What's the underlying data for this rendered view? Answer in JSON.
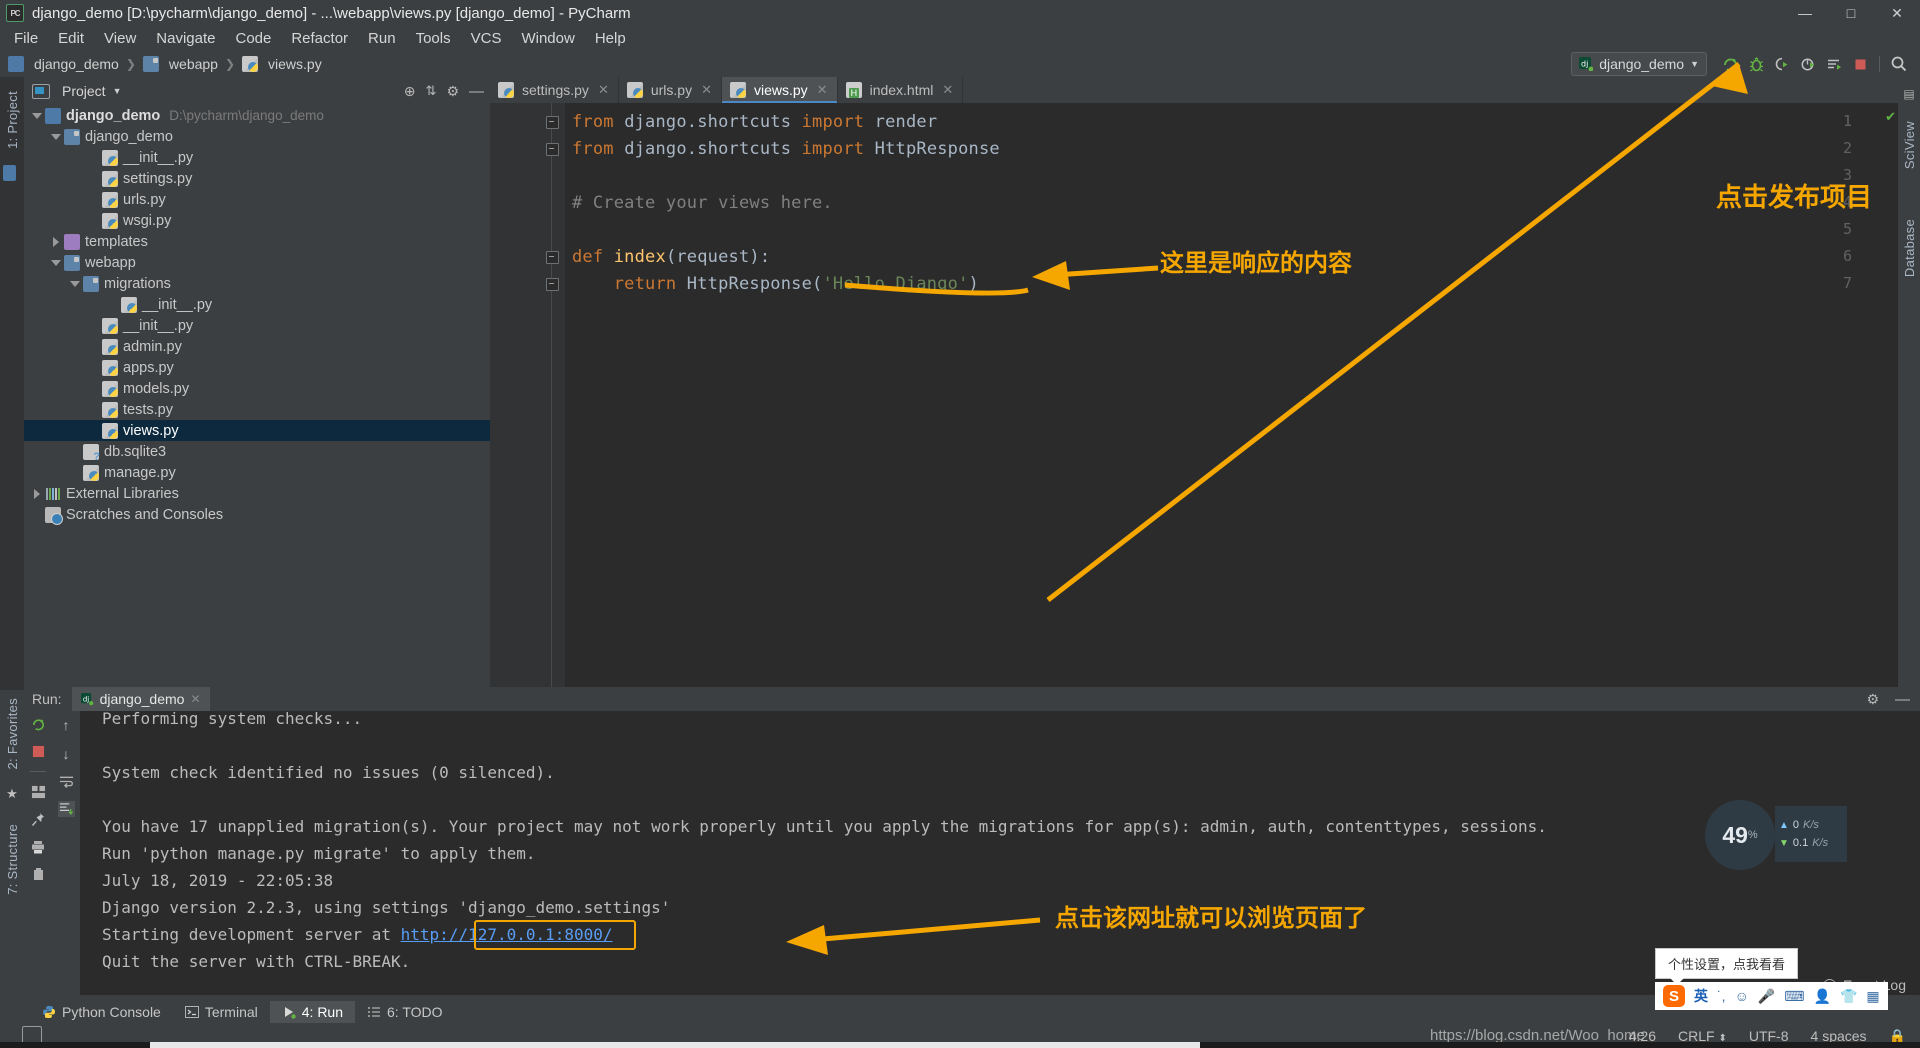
{
  "window": {
    "title": "django_demo [D:\\pycharm\\django_demo] - ...\\webapp\\views.py [django_demo] - PyCharm",
    "app_icon_text": "PC",
    "minimize": "—",
    "maximize": "□",
    "close": "✕"
  },
  "menu": [
    "File",
    "Edit",
    "View",
    "Navigate",
    "Code",
    "Refactor",
    "Run",
    "Tools",
    "VCS",
    "Window",
    "Help"
  ],
  "breadcrumb": [
    "django_demo",
    "webapp",
    "views.py"
  ],
  "toolbar": {
    "run_config": "django_demo",
    "icons": [
      "rerun-icon",
      "debug-icon",
      "run-coverage-icon",
      "profile-icon",
      "run-with-console-icon",
      "stop-icon",
      "search-everywhere-icon"
    ]
  },
  "left_strip": {
    "project_label": "1: Project",
    "structure_label": "7: Structure",
    "favorites_label": "2: Favorites"
  },
  "right_strip": {
    "sciview_label": "SciView",
    "database_label": "Database"
  },
  "project_panel": {
    "title": "Project",
    "tree": [
      {
        "depth": 0,
        "twisty": "open",
        "icon": "folder-icon",
        "label": "django_demo",
        "sub": "D:\\pycharm\\django_demo",
        "bold": true,
        "selected": false
      },
      {
        "depth": 1,
        "twisty": "open",
        "icon": "folder-module-icon",
        "label": "django_demo",
        "sub": "",
        "bold": false,
        "selected": false
      },
      {
        "depth": 3,
        "twisty": "none",
        "icon": "python-file-icon",
        "label": "__init__.py",
        "sub": "",
        "bold": false,
        "selected": false
      },
      {
        "depth": 3,
        "twisty": "none",
        "icon": "python-file-icon",
        "label": "settings.py",
        "sub": "",
        "bold": false,
        "selected": false
      },
      {
        "depth": 3,
        "twisty": "none",
        "icon": "python-file-icon",
        "label": "urls.py",
        "sub": "",
        "bold": false,
        "selected": false
      },
      {
        "depth": 3,
        "twisty": "none",
        "icon": "python-file-icon",
        "label": "wsgi.py",
        "sub": "",
        "bold": false,
        "selected": false
      },
      {
        "depth": 1,
        "twisty": "closed",
        "icon": "folder-templates-icon",
        "label": "templates",
        "sub": "",
        "bold": false,
        "selected": false
      },
      {
        "depth": 1,
        "twisty": "open",
        "icon": "folder-module-icon",
        "label": "webapp",
        "sub": "",
        "bold": false,
        "selected": false
      },
      {
        "depth": 2,
        "twisty": "open",
        "icon": "folder-module-icon",
        "label": "migrations",
        "sub": "",
        "bold": false,
        "selected": false
      },
      {
        "depth": 4,
        "twisty": "none",
        "icon": "python-file-icon",
        "label": "__init__.py",
        "sub": "",
        "bold": false,
        "selected": false
      },
      {
        "depth": 3,
        "twisty": "none",
        "icon": "python-file-icon",
        "label": "__init__.py",
        "sub": "",
        "bold": false,
        "selected": false
      },
      {
        "depth": 3,
        "twisty": "none",
        "icon": "python-file-icon",
        "label": "admin.py",
        "sub": "",
        "bold": false,
        "selected": false
      },
      {
        "depth": 3,
        "twisty": "none",
        "icon": "python-file-icon",
        "label": "apps.py",
        "sub": "",
        "bold": false,
        "selected": false
      },
      {
        "depth": 3,
        "twisty": "none",
        "icon": "python-file-icon",
        "label": "models.py",
        "sub": "",
        "bold": false,
        "selected": false
      },
      {
        "depth": 3,
        "twisty": "none",
        "icon": "python-file-icon",
        "label": "tests.py",
        "sub": "",
        "bold": false,
        "selected": false
      },
      {
        "depth": 3,
        "twisty": "none",
        "icon": "python-file-icon",
        "label": "views.py",
        "sub": "",
        "bold": false,
        "selected": true
      },
      {
        "depth": 2,
        "twisty": "none",
        "icon": "database-file-icon",
        "label": "db.sqlite3",
        "sub": "",
        "bold": false,
        "selected": false
      },
      {
        "depth": 2,
        "twisty": "none",
        "icon": "python-file-icon",
        "label": "manage.py",
        "sub": "",
        "bold": false,
        "selected": false
      },
      {
        "depth": 0,
        "twisty": "closed",
        "icon": "external-libraries-icon",
        "label": "External Libraries",
        "sub": "",
        "bold": false,
        "selected": false
      },
      {
        "depth": 0,
        "twisty": "none",
        "icon": "scratches-icon",
        "label": "Scratches and Consoles",
        "sub": "",
        "bold": false,
        "selected": false
      }
    ]
  },
  "editor": {
    "tabs": [
      {
        "label": "settings.py",
        "icon": "python-file-icon",
        "active": false
      },
      {
        "label": "urls.py",
        "icon": "python-file-icon",
        "active": false
      },
      {
        "label": "views.py",
        "icon": "python-file-icon",
        "active": true
      },
      {
        "label": "index.html",
        "icon": "html-file-icon",
        "active": false
      }
    ],
    "line_numbers": [
      "1",
      "2",
      "3",
      "4",
      "5",
      "6",
      "7"
    ],
    "code_lines": [
      {
        "n": 1,
        "tokens": [
          {
            "t": "from ",
            "c": "kw"
          },
          {
            "t": "django.shortcuts ",
            "c": "ident"
          },
          {
            "t": "import ",
            "c": "kw"
          },
          {
            "t": "render",
            "c": "ident"
          }
        ]
      },
      {
        "n": 2,
        "tokens": [
          {
            "t": "from ",
            "c": "kw"
          },
          {
            "t": "django.shortcuts ",
            "c": "ident"
          },
          {
            "t": "import ",
            "c": "kw"
          },
          {
            "t": "HttpResponse",
            "c": "ident"
          }
        ]
      },
      {
        "n": 3,
        "tokens": []
      },
      {
        "n": 4,
        "tokens": [
          {
            "t": "# Create your views here.",
            "c": "cmt"
          }
        ]
      },
      {
        "n": 5,
        "tokens": []
      },
      {
        "n": 6,
        "tokens": [
          {
            "t": "def ",
            "c": "kw"
          },
          {
            "t": "index",
            "c": "fn"
          },
          {
            "t": "(request):",
            "c": "ident"
          }
        ]
      },
      {
        "n": 7,
        "tokens": [
          {
            "t": "    return ",
            "c": "kw"
          },
          {
            "t": "HttpResponse(",
            "c": "ident"
          },
          {
            "t": "'Hello Django'",
            "c": "str"
          },
          {
            "t": ")",
            "c": "ident"
          }
        ]
      }
    ]
  },
  "run_panel": {
    "label": "Run:",
    "tab": "django_demo",
    "console_lines": [
      "Performing system checks...",
      "",
      "System check identified no issues (0 silenced).",
      "",
      "You have 17 unapplied migration(s). Your project may not work properly until you apply the migrations for app(s): admin, auth, contenttypes, sessions.",
      "Run 'python manage.py migrate' to apply them.",
      "July 18, 2019 - 22:05:38",
      "Django version 2.2.3, using settings 'django_demo.settings'",
      "Starting development server at ",
      "Quit the server with CTRL-BREAK."
    ],
    "server_url": "http://127.0.0.1:8000/",
    "settings_icon": "gear-icon",
    "minimize_icon": "minimize-icon"
  },
  "bottom_bar": [
    {
      "label": "Python Console",
      "icon": "python-console-icon",
      "active": false,
      "mnemonic": ""
    },
    {
      "label": "Terminal",
      "icon": "terminal-icon",
      "active": false,
      "mnemonic": ""
    },
    {
      "label": "4: Run",
      "icon": "run-icon",
      "active": true,
      "mnemonic": "4"
    },
    {
      "label": "6: TODO",
      "icon": "todo-icon",
      "active": false,
      "mnemonic": "6"
    }
  ],
  "status_bar": {
    "event_log": "Event Log",
    "caret_position": "4:26",
    "line_separator": "CRLF",
    "encoding": "UTF-8",
    "indent": "4 spaces",
    "lock_icon": "lock-icon"
  },
  "annotations": {
    "publish_project": "点击发布项目",
    "response_content": "这里是响应的内容",
    "click_url": "点击该网址就可以浏览页面了",
    "color": "#f5a700"
  },
  "net_widget": {
    "percent": "49",
    "percent_sign": "%",
    "upload": "0",
    "upload_unit": "K/s",
    "download": "0.1",
    "download_unit": "K/s"
  },
  "ime": {
    "tooltip": "个性设置，点我看看",
    "logo": "S",
    "mode": "英",
    "icons": [
      "punctuation-icon",
      "emoji-icon",
      "voice-icon",
      "keyboard-icon",
      "user-icon",
      "skin-icon",
      "toolbox-icon"
    ]
  },
  "watermark": "https://blog.csdn.net/Woo_home"
}
